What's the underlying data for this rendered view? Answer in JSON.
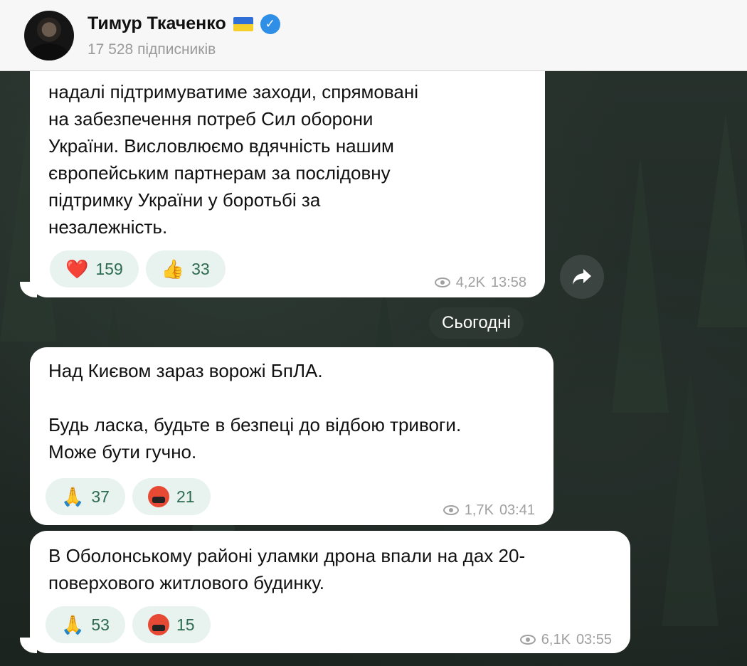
{
  "channel": {
    "name": "Тимур Ткаченко",
    "subscribers": "17 528 підписників"
  },
  "messages": [
    {
      "lines": [
        "надалі підтримуватиме заходи, спрямовані",
        "на забезпечення потреб Сил оборони",
        "України. Висловлюємо вдячність нашим",
        "європейським партнерам за послідовну",
        "підтримку України у боротьбі за",
        "незалежність."
      ],
      "reactions": [
        {
          "emoji": "❤️",
          "count": "159"
        },
        {
          "emoji": "👍",
          "count": "33"
        }
      ],
      "views": "4,2K",
      "time": "13:58"
    },
    {
      "lines": [
        "Над Києвом зараз ворожі БпЛА.",
        "",
        "Будь ласка, будьте в безпеці до відбою тривоги.",
        "Може бути гучно."
      ],
      "reactions": [
        {
          "emoji": "🙏",
          "count": "37"
        },
        {
          "emoji": "🤬",
          "count": "21"
        }
      ],
      "views": "1,7K",
      "time": "03:41"
    },
    {
      "lines": [
        "В Оболонському районі уламки дрона впали на дах 20-",
        "поверхового житлового будинку."
      ],
      "reactions": [
        {
          "emoji": "🙏",
          "count": "53"
        },
        {
          "emoji": "🤬",
          "count": "15"
        }
      ],
      "views": "6,1K",
      "time": "03:55"
    }
  ],
  "date_separator": "Сьогодні",
  "icons": {
    "verified": "verified-badge-icon",
    "flag": "ukraine-flag-icon",
    "forward": "forward-arrow-icon",
    "views": "eye-icon"
  },
  "colors": {
    "reaction_bg": "#e8f2ee",
    "reaction_text": "#2c6b51",
    "verified": "#2f8fe6"
  }
}
